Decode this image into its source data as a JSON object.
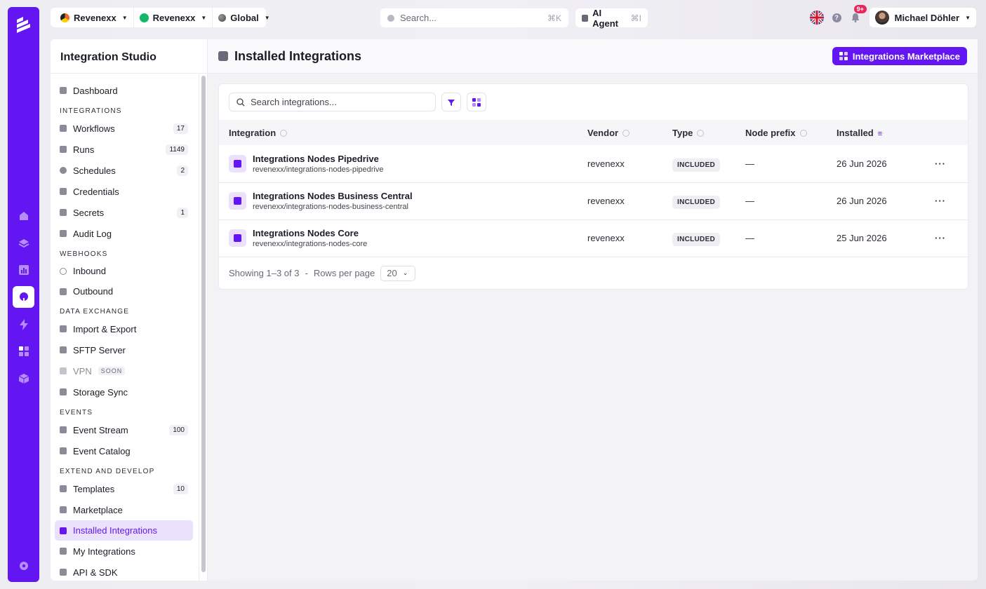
{
  "topbar": {
    "org1": "Revenexx",
    "org2": "Revenexx",
    "scope": "Global",
    "search_placeholder": "Search...",
    "search_shortcut": "⌘K",
    "ai_agent_label": "AI Agent",
    "ai_agent_shortcut": "⌘I",
    "notifications_badge": "9+",
    "user_name": "Michael Döhler",
    "help_label": "?"
  },
  "sidebar": {
    "title": "Integration Studio",
    "dashboard": "Dashboard",
    "sections": {
      "integrations": "INTEGRATIONS",
      "webhooks": "WEBHOOKS",
      "data_exchange": "DATA EXCHANGE",
      "events": "EVENTS",
      "extend": "EXTEND AND DEVELOP"
    },
    "integrations": [
      {
        "label": "Workflows",
        "count": "17"
      },
      {
        "label": "Runs",
        "count": "1149"
      },
      {
        "label": "Schedules",
        "count": "2"
      },
      {
        "label": "Credentials",
        "count": ""
      },
      {
        "label": "Secrets",
        "count": "1"
      },
      {
        "label": "Audit Log",
        "count": ""
      }
    ],
    "webhooks": [
      {
        "label": "Inbound"
      },
      {
        "label": "Outbound"
      }
    ],
    "data_exchange": [
      {
        "label": "Import & Export"
      },
      {
        "label": "SFTP Server"
      },
      {
        "label": "VPN",
        "tag": "SOON"
      },
      {
        "label": "Storage Sync"
      }
    ],
    "events": [
      {
        "label": "Event Stream",
        "count": "100"
      },
      {
        "label": "Event Catalog",
        "count": ""
      }
    ],
    "extend": [
      {
        "label": "Templates",
        "count": "10"
      },
      {
        "label": "Marketplace"
      },
      {
        "label": "Installed Integrations"
      },
      {
        "label": "My Integrations"
      },
      {
        "label": "API & SDK"
      }
    ]
  },
  "main": {
    "title": "Installed Integrations",
    "marketplace_button": "Integrations Marketplace",
    "search_placeholder": "Search integrations...",
    "columns": [
      "Integration",
      "Vendor",
      "Type",
      "Node prefix",
      "Installed"
    ],
    "rows": [
      {
        "name": "Integrations Nodes Pipedrive",
        "path": "revenexx/integrations-nodes-pipedrive",
        "vendor": "revenexx",
        "type": "INCLUDED",
        "prefix": "—",
        "installed": "26 Jun 2026"
      },
      {
        "name": "Integrations Nodes Business Central",
        "path": "revenexx/integrations-nodes-business-central",
        "vendor": "revenexx",
        "type": "INCLUDED",
        "prefix": "—",
        "installed": "26 Jun 2026"
      },
      {
        "name": "Integrations Nodes Core",
        "path": "revenexx/integrations-nodes-core",
        "vendor": "revenexx",
        "type": "INCLUDED",
        "prefix": "—",
        "installed": "25 Jun 2026"
      }
    ],
    "more_label": "···",
    "footer": {
      "showing": "Showing 1–3 of 3",
      "separator": "-",
      "rows_per_page": "Rows per page",
      "rows_value": "20"
    }
  },
  "colors": {
    "brand": "#6316f2",
    "badge": "#ea2559"
  }
}
